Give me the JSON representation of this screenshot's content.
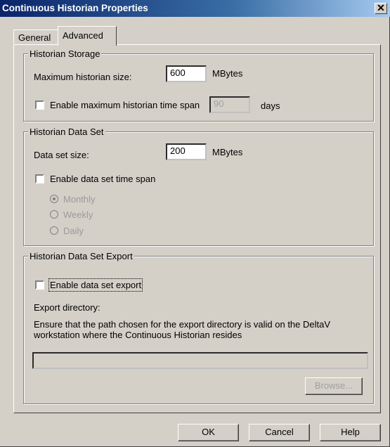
{
  "window": {
    "title": "Continuous Historian Properties",
    "close_glyph": "✕"
  },
  "tabs": [
    {
      "label": "General"
    },
    {
      "label": "Advanced"
    }
  ],
  "storage": {
    "legend": "Historian Storage",
    "max_size_label": "Maximum historian size:",
    "max_size_value": "600",
    "max_size_unit": "MBytes",
    "timespan_label": "Enable maximum historian time span",
    "timespan_checked": false,
    "timespan_value": "90",
    "timespan_unit": "days"
  },
  "dataset": {
    "legend": "Historian Data Set",
    "size_label": "Data set size:",
    "size_value": "200",
    "size_unit": "MBytes",
    "timespan_label": "Enable data set time span",
    "timespan_checked": false,
    "options": [
      {
        "label": "Monthly",
        "selected": true
      },
      {
        "label": "Weekly",
        "selected": false
      },
      {
        "label": "Daily",
        "selected": false
      }
    ]
  },
  "export": {
    "legend": "Historian Data Set Export",
    "enable_label": "Enable data set export",
    "enable_checked": false,
    "directory_label": "Export directory:",
    "note_line1": "Ensure that the path chosen for the export directory is valid on the DeltaV",
    "note_line2": "workstation where the Continuous Historian resides",
    "path_value": "",
    "browse_label": "Browse..."
  },
  "buttons": {
    "ok": "OK",
    "cancel": "Cancel",
    "help": "Help"
  }
}
